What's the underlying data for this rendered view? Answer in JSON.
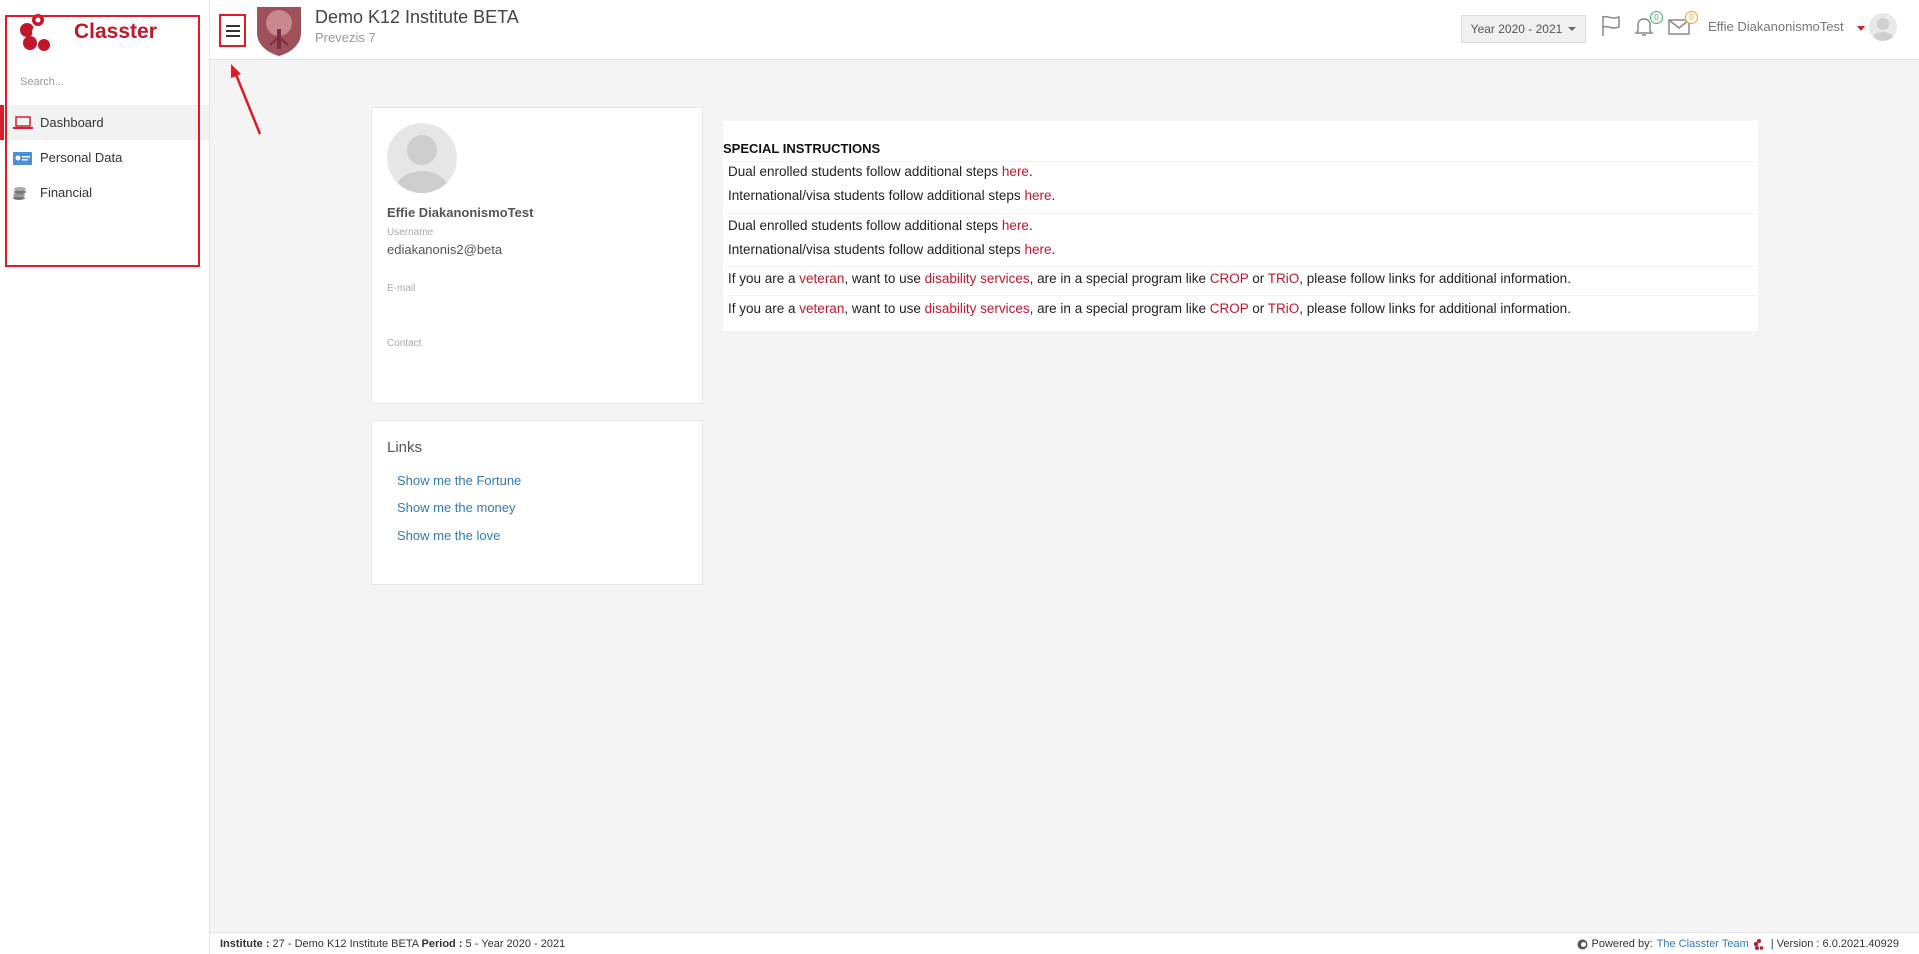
{
  "sidebar": {
    "brand": "Classter",
    "search_placeholder": "Search...",
    "items": [
      {
        "label": "Dashboard"
      },
      {
        "label": "Personal Data"
      },
      {
        "label": "Financial"
      }
    ]
  },
  "header": {
    "institute_title": "Demo K12 Institute BETA",
    "institute_subtitle": "Prevezis 7",
    "year_selector": "Year 2020 - 2021",
    "notifications_count": "0",
    "messages_count": "0",
    "user_name": "Effie DiakanonismoTest"
  },
  "profile": {
    "name": "Effie DiakanonismoTest",
    "username_label": "Username",
    "username": "ediakanonis2@beta",
    "email_label": "E-mail",
    "contact_label": "Contact"
  },
  "links": {
    "title": "Links",
    "items": [
      {
        "label": "Show me the Fortune"
      },
      {
        "label": "Show me the money"
      },
      {
        "label": "Show me the love"
      }
    ]
  },
  "special": {
    "title": "SPECIAL INSTRUCTIONS",
    "dual_text": "Dual enrolled students follow additional steps ",
    "intl_text": "International/visa students follow additional steps ",
    "here": "here",
    "period": ".",
    "vet_1": "If you are a ",
    "veteran": "veteran",
    "vet_2": ", want to use ",
    "disability": "disability services",
    "vet_3": ", are in a special program like ",
    "crop": "CROP",
    "or": " or ",
    "trio": "TRiO",
    "vet_4": ", please follow links for additional information."
  },
  "footer": {
    "institute_label": "Institute :",
    "institute_value": " 27 - Demo K12 Institute BETA ",
    "period_label": "Period :",
    "period_value": " 5 - Year 2020 - 2021",
    "powered_by": "Powered by:",
    "team": "The Classter Team",
    "version": "| Version : 6.0.2021.40929"
  },
  "colors": {
    "accent": "#d71e2b",
    "link_blue": "#337ab7",
    "annotation_red": "#e01b24"
  }
}
